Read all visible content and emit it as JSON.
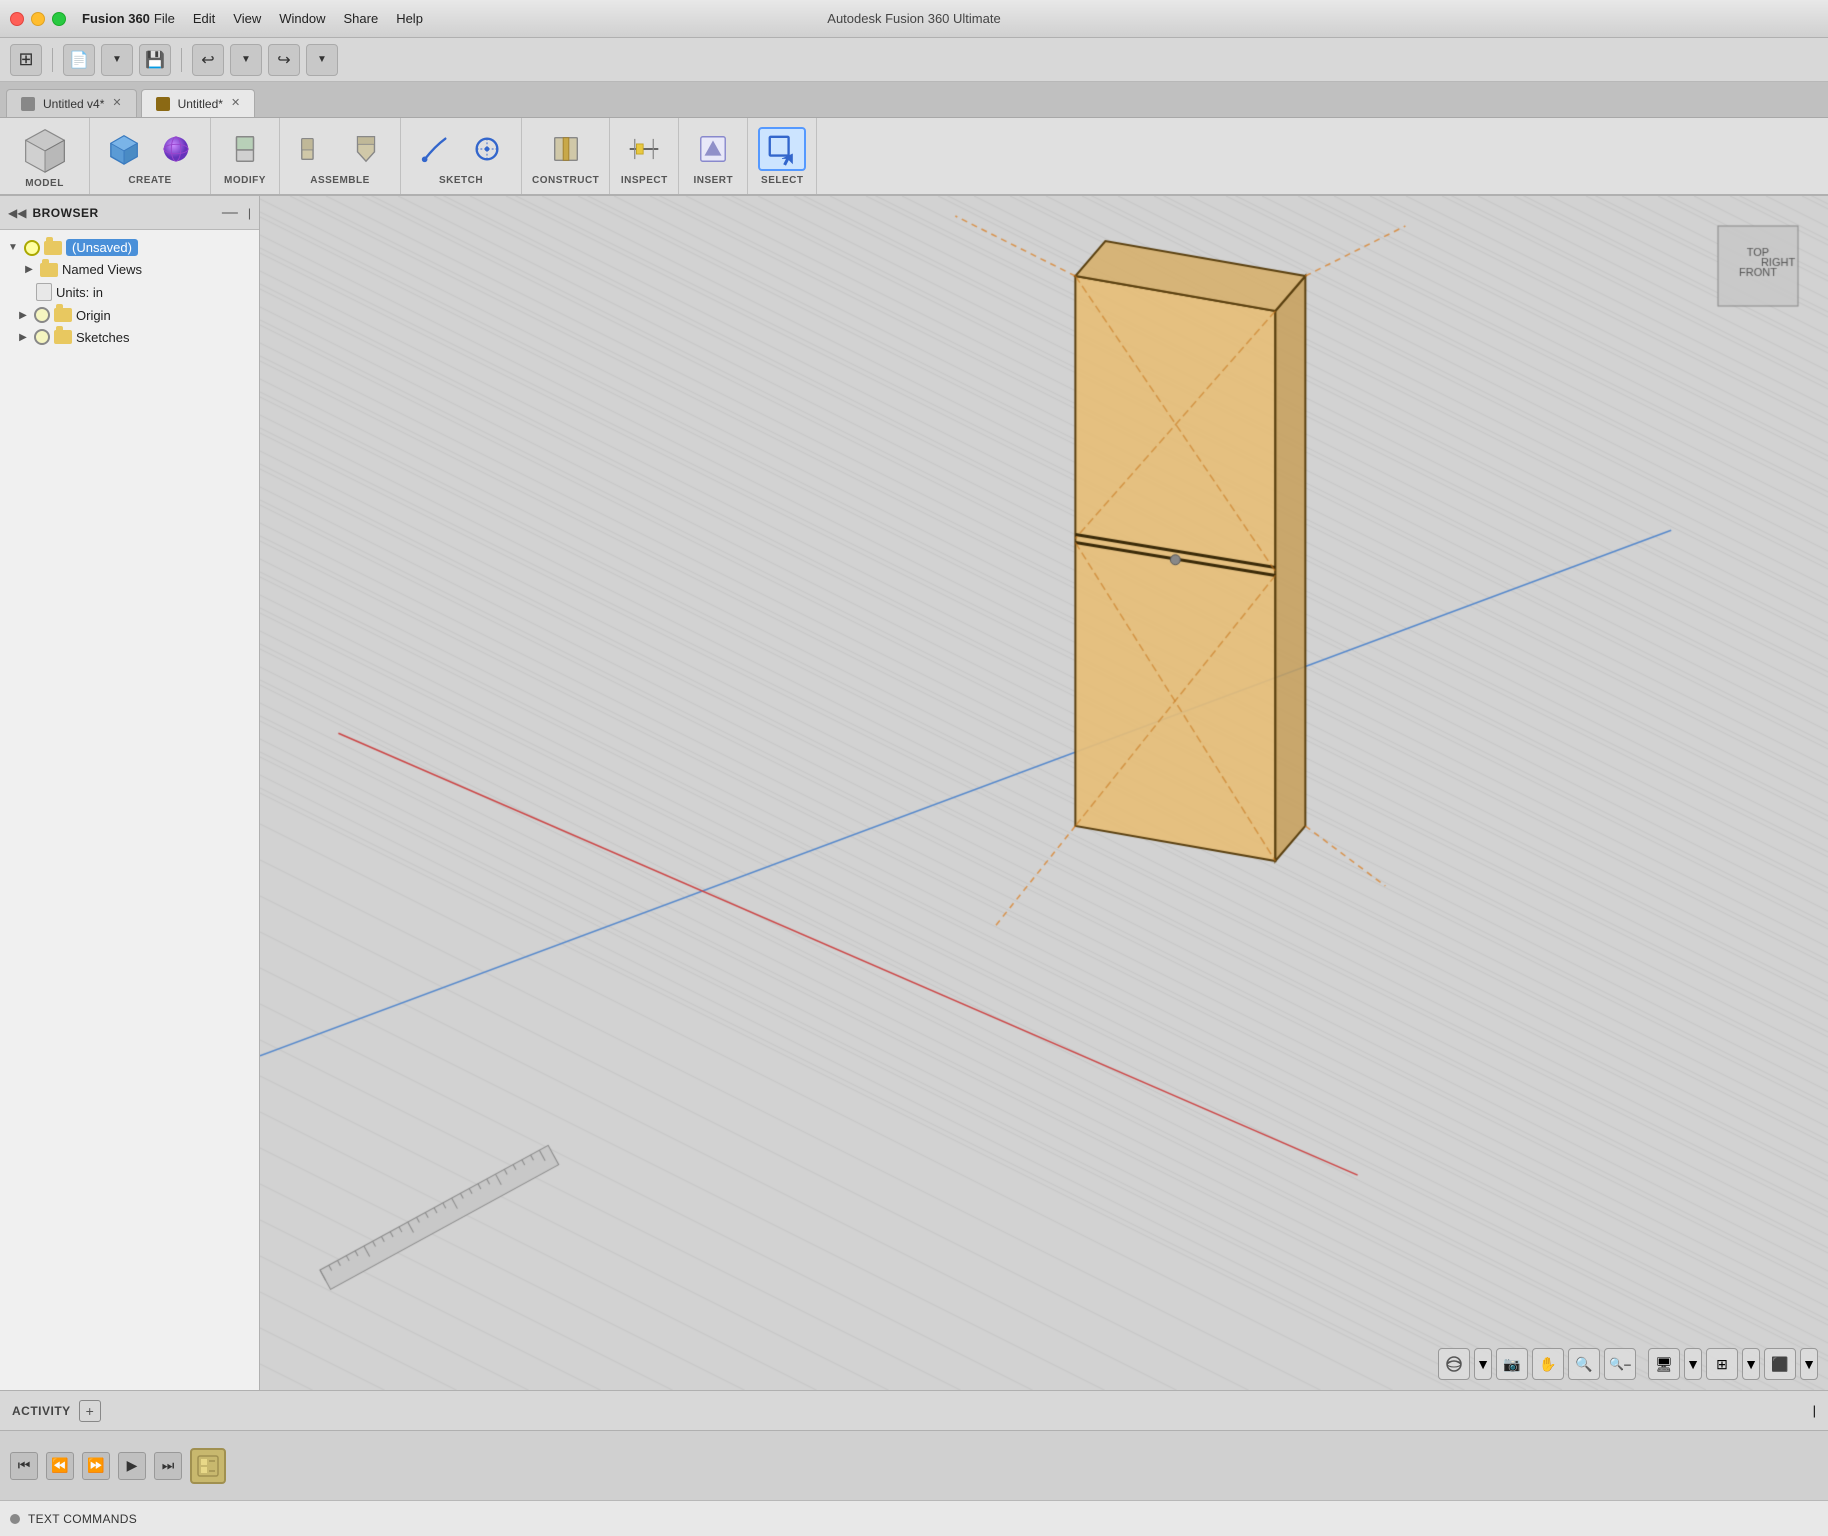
{
  "app": {
    "name": "Fusion 360",
    "title": "Autodesk Fusion 360 Ultimate"
  },
  "titlebar": {
    "menus": [
      "File",
      "Edit",
      "View",
      "Window",
      "Share",
      "Help"
    ]
  },
  "tabs": [
    {
      "id": "tab1",
      "label": "Untitled v4*",
      "active": false
    },
    {
      "id": "tab2",
      "label": "Untitled*",
      "active": true
    }
  ],
  "toolbar": {
    "sections": [
      {
        "id": "model",
        "label": "MODEL"
      },
      {
        "id": "create",
        "label": "CREATE"
      },
      {
        "id": "modify",
        "label": "MODIFY"
      },
      {
        "id": "assemble",
        "label": "ASSEMBLE"
      },
      {
        "id": "sketch",
        "label": "SKETCH"
      },
      {
        "id": "construct",
        "label": "CONSTRUCT"
      },
      {
        "id": "inspect",
        "label": "INSPECT"
      },
      {
        "id": "insert",
        "label": "INSERT"
      },
      {
        "id": "select",
        "label": "SELECT"
      }
    ]
  },
  "browser": {
    "title": "BROWSER",
    "tree": [
      {
        "id": "unsaved",
        "indent": 0,
        "hasExpander": true,
        "expanded": true,
        "hasLight": true,
        "hasFolder": true,
        "label": "(Unsaved)",
        "selected": true
      },
      {
        "id": "named-views",
        "indent": 1,
        "hasExpander": true,
        "expanded": false,
        "hasLight": false,
        "hasFolder": true,
        "label": "Named Views",
        "selected": false
      },
      {
        "id": "units",
        "indent": 1,
        "hasExpander": false,
        "hasLight": false,
        "hasFolder": false,
        "hasDoc": true,
        "label": "Units: in",
        "selected": false
      },
      {
        "id": "origin",
        "indent": 1,
        "hasExpander": true,
        "expanded": false,
        "hasLight": true,
        "hasFolder": true,
        "label": "Origin",
        "selected": false
      },
      {
        "id": "sketches",
        "indent": 1,
        "hasExpander": true,
        "expanded": false,
        "hasLight": true,
        "hasFolder": true,
        "label": "Sketches",
        "selected": false
      }
    ]
  },
  "activity": {
    "label": "ACTIVITY",
    "plus_label": "+"
  },
  "text_commands": {
    "label": "TEXT COMMANDS"
  },
  "viewport": {
    "bg_color": "#d4d4d4"
  }
}
